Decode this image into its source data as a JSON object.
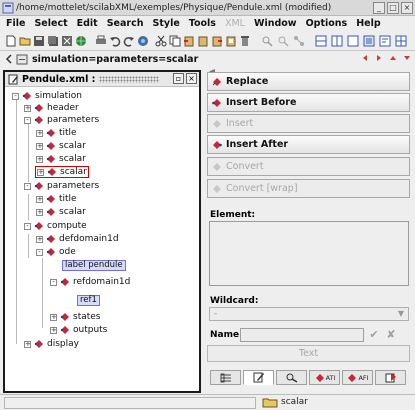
{
  "window": {
    "title": "/home/mottelet/scilabXML/exemples/Physique/Pendule.xml (modified)"
  },
  "menu": [
    {
      "label": "File",
      "enabled": true
    },
    {
      "label": "Select",
      "enabled": true
    },
    {
      "label": "Edit",
      "enabled": true
    },
    {
      "label": "Search",
      "enabled": true
    },
    {
      "label": "Style",
      "enabled": true
    },
    {
      "label": "Tools",
      "enabled": true
    },
    {
      "label": "XML",
      "enabled": false
    },
    {
      "label": "Window",
      "enabled": true
    },
    {
      "label": "Options",
      "enabled": true
    },
    {
      "label": "Help",
      "enabled": true
    }
  ],
  "pathbar": {
    "path": "simulation=parameters=scalar"
  },
  "tree_panel": {
    "tab_label": "Pendule.xml :",
    "nodes": [
      {
        "label": "simulation",
        "expander": "-"
      },
      {
        "label": "header",
        "expander": "+"
      },
      {
        "label": "parameters",
        "expander": "-"
      },
      {
        "label": "title",
        "expander": "+"
      },
      {
        "label": "scalar",
        "expander": "+"
      },
      {
        "label": "scalar",
        "expander": "+"
      },
      {
        "label": "scalar",
        "expander": "+",
        "selected": true
      },
      {
        "label": "parameters",
        "expander": "-"
      },
      {
        "label": "title",
        "expander": "+"
      },
      {
        "label": "scalar",
        "expander": "+"
      },
      {
        "label": "compute",
        "expander": "-"
      },
      {
        "label": "defdomain1d",
        "expander": "+"
      },
      {
        "label": "ode",
        "expander": "-"
      },
      {
        "label": "label pendule",
        "kind": "text"
      },
      {
        "label": "refdomain1d",
        "expander": "-"
      },
      {
        "label": "ref1",
        "kind": "text"
      },
      {
        "label": "states",
        "expander": "+"
      },
      {
        "label": "outputs",
        "expander": "+"
      },
      {
        "label": "display",
        "expander": "+"
      }
    ]
  },
  "actions": {
    "replace": "Replace",
    "insert_before": "Insert Before",
    "insert": "Insert",
    "insert_after": "Insert After",
    "convert": "Convert",
    "convert_wrap": "Convert [wrap]"
  },
  "form": {
    "element_label": "Element:",
    "wildcard_label": "Wildcard:",
    "wildcard_value": "-",
    "name_label": "Name:",
    "text_button": "Text"
  },
  "tabs": [
    {
      "icon": "attributes-icon",
      "label": ""
    },
    {
      "icon": "edit-icon",
      "label": "",
      "active": true
    },
    {
      "icon": "tools-icon",
      "label": ""
    },
    {
      "icon": "ati-icon",
      "label": "ATI"
    },
    {
      "icon": "afi-icon",
      "label": "AFI"
    },
    {
      "icon": "export-icon",
      "label": ""
    }
  ],
  "status": {
    "text": "scalar"
  }
}
